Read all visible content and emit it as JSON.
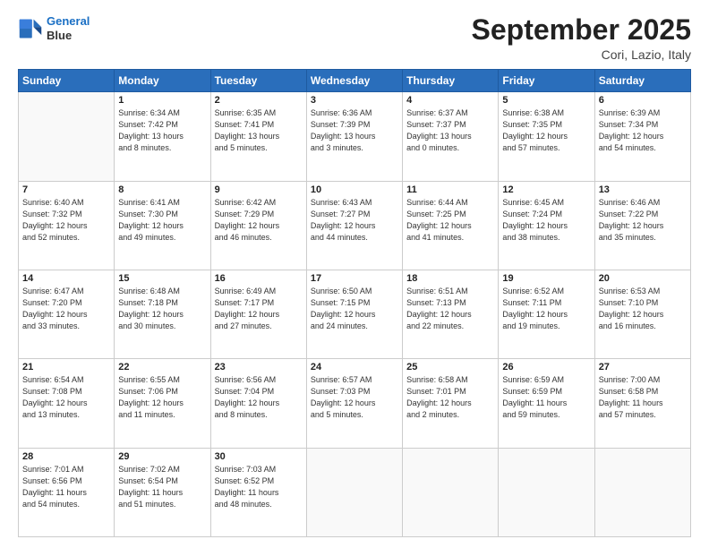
{
  "header": {
    "logo_line1": "General",
    "logo_line2": "Blue",
    "month_title": "September 2025",
    "location": "Cori, Lazio, Italy"
  },
  "weekdays": [
    "Sunday",
    "Monday",
    "Tuesday",
    "Wednesday",
    "Thursday",
    "Friday",
    "Saturday"
  ],
  "weeks": [
    [
      {
        "day": "",
        "info": ""
      },
      {
        "day": "1",
        "info": "Sunrise: 6:34 AM\nSunset: 7:42 PM\nDaylight: 13 hours\nand 8 minutes."
      },
      {
        "day": "2",
        "info": "Sunrise: 6:35 AM\nSunset: 7:41 PM\nDaylight: 13 hours\nand 5 minutes."
      },
      {
        "day": "3",
        "info": "Sunrise: 6:36 AM\nSunset: 7:39 PM\nDaylight: 13 hours\nand 3 minutes."
      },
      {
        "day": "4",
        "info": "Sunrise: 6:37 AM\nSunset: 7:37 PM\nDaylight: 13 hours\nand 0 minutes."
      },
      {
        "day": "5",
        "info": "Sunrise: 6:38 AM\nSunset: 7:35 PM\nDaylight: 12 hours\nand 57 minutes."
      },
      {
        "day": "6",
        "info": "Sunrise: 6:39 AM\nSunset: 7:34 PM\nDaylight: 12 hours\nand 54 minutes."
      }
    ],
    [
      {
        "day": "7",
        "info": "Sunrise: 6:40 AM\nSunset: 7:32 PM\nDaylight: 12 hours\nand 52 minutes."
      },
      {
        "day": "8",
        "info": "Sunrise: 6:41 AM\nSunset: 7:30 PM\nDaylight: 12 hours\nand 49 minutes."
      },
      {
        "day": "9",
        "info": "Sunrise: 6:42 AM\nSunset: 7:29 PM\nDaylight: 12 hours\nand 46 minutes."
      },
      {
        "day": "10",
        "info": "Sunrise: 6:43 AM\nSunset: 7:27 PM\nDaylight: 12 hours\nand 44 minutes."
      },
      {
        "day": "11",
        "info": "Sunrise: 6:44 AM\nSunset: 7:25 PM\nDaylight: 12 hours\nand 41 minutes."
      },
      {
        "day": "12",
        "info": "Sunrise: 6:45 AM\nSunset: 7:24 PM\nDaylight: 12 hours\nand 38 minutes."
      },
      {
        "day": "13",
        "info": "Sunrise: 6:46 AM\nSunset: 7:22 PM\nDaylight: 12 hours\nand 35 minutes."
      }
    ],
    [
      {
        "day": "14",
        "info": "Sunrise: 6:47 AM\nSunset: 7:20 PM\nDaylight: 12 hours\nand 33 minutes."
      },
      {
        "day": "15",
        "info": "Sunrise: 6:48 AM\nSunset: 7:18 PM\nDaylight: 12 hours\nand 30 minutes."
      },
      {
        "day": "16",
        "info": "Sunrise: 6:49 AM\nSunset: 7:17 PM\nDaylight: 12 hours\nand 27 minutes."
      },
      {
        "day": "17",
        "info": "Sunrise: 6:50 AM\nSunset: 7:15 PM\nDaylight: 12 hours\nand 24 minutes."
      },
      {
        "day": "18",
        "info": "Sunrise: 6:51 AM\nSunset: 7:13 PM\nDaylight: 12 hours\nand 22 minutes."
      },
      {
        "day": "19",
        "info": "Sunrise: 6:52 AM\nSunset: 7:11 PM\nDaylight: 12 hours\nand 19 minutes."
      },
      {
        "day": "20",
        "info": "Sunrise: 6:53 AM\nSunset: 7:10 PM\nDaylight: 12 hours\nand 16 minutes."
      }
    ],
    [
      {
        "day": "21",
        "info": "Sunrise: 6:54 AM\nSunset: 7:08 PM\nDaylight: 12 hours\nand 13 minutes."
      },
      {
        "day": "22",
        "info": "Sunrise: 6:55 AM\nSunset: 7:06 PM\nDaylight: 12 hours\nand 11 minutes."
      },
      {
        "day": "23",
        "info": "Sunrise: 6:56 AM\nSunset: 7:04 PM\nDaylight: 12 hours\nand 8 minutes."
      },
      {
        "day": "24",
        "info": "Sunrise: 6:57 AM\nSunset: 7:03 PM\nDaylight: 12 hours\nand 5 minutes."
      },
      {
        "day": "25",
        "info": "Sunrise: 6:58 AM\nSunset: 7:01 PM\nDaylight: 12 hours\nand 2 minutes."
      },
      {
        "day": "26",
        "info": "Sunrise: 6:59 AM\nSunset: 6:59 PM\nDaylight: 11 hours\nand 59 minutes."
      },
      {
        "day": "27",
        "info": "Sunrise: 7:00 AM\nSunset: 6:58 PM\nDaylight: 11 hours\nand 57 minutes."
      }
    ],
    [
      {
        "day": "28",
        "info": "Sunrise: 7:01 AM\nSunset: 6:56 PM\nDaylight: 11 hours\nand 54 minutes."
      },
      {
        "day": "29",
        "info": "Sunrise: 7:02 AM\nSunset: 6:54 PM\nDaylight: 11 hours\nand 51 minutes."
      },
      {
        "day": "30",
        "info": "Sunrise: 7:03 AM\nSunset: 6:52 PM\nDaylight: 11 hours\nand 48 minutes."
      },
      {
        "day": "",
        "info": ""
      },
      {
        "day": "",
        "info": ""
      },
      {
        "day": "",
        "info": ""
      },
      {
        "day": "",
        "info": ""
      }
    ]
  ]
}
